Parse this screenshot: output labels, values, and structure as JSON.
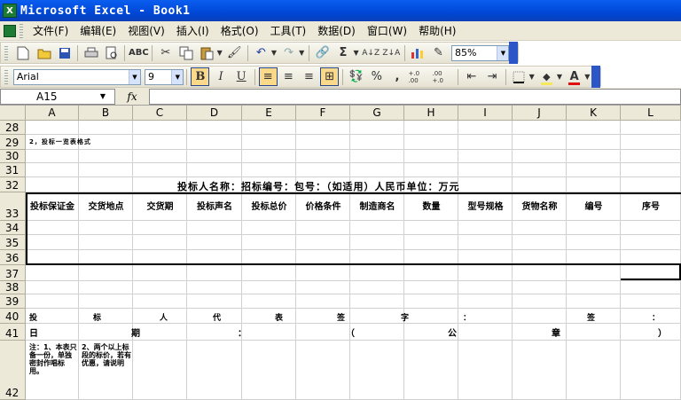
{
  "window": {
    "title": "Microsoft Excel - Book1",
    "icon": "excel-icon"
  },
  "menu": [
    "文件(F)",
    "编辑(E)",
    "视图(V)",
    "插入(I)",
    "格式(O)",
    "工具(T)",
    "数据(D)",
    "窗口(W)",
    "帮助(H)"
  ],
  "toolbar": {
    "zoom": "85%"
  },
  "format_toolbar": {
    "font": "Arial",
    "size": "9",
    "bold": "B",
    "italic": "I",
    "underline": "U",
    "percent": "%",
    "comma": ",",
    "inc_decimal": "+.0 .00",
    "dec_decimal": ".00 +.0",
    "font_color": "A",
    "fill_color_hex": "#f5e85a",
    "font_color_hex": "#e01010"
  },
  "formula_bar": {
    "cell_ref": "A15",
    "fx": "fx",
    "formula": ""
  },
  "columns": [
    "A",
    "B",
    "C",
    "D",
    "E",
    "F",
    "G",
    "H",
    "I",
    "J",
    "K",
    "L"
  ],
  "rows": [
    "28",
    "29",
    "30",
    "31",
    "32",
    "33",
    "34",
    "35",
    "36",
    "37",
    "38",
    "39",
    "40",
    "41",
    "42"
  ],
  "sheet": {
    "r29a": "2，投标一览表格式",
    "r32": "投标人名称：招标编号：包号：（如适用）人民币单位：万元",
    "r33": [
      "投标保证金",
      "交货地点",
      "交货期",
      "投标声名",
      "投标总价",
      "价格条件",
      "制造商名",
      "数量",
      "型号规格",
      "货物名称",
      "编号",
      "序号"
    ],
    "r40": [
      "投",
      "标",
      "人",
      "代",
      "表",
      "签",
      "字",
      "：",
      "签",
      "："
    ],
    "r41": [
      "日",
      "期",
      "：",
      "（",
      "公",
      "章",
      "）"
    ],
    "r42a": "注：1、本表只备一份，单独密封作唱标用。",
    "r42b": "2、两个以上标段的标价，若有优惠，请说明"
  }
}
